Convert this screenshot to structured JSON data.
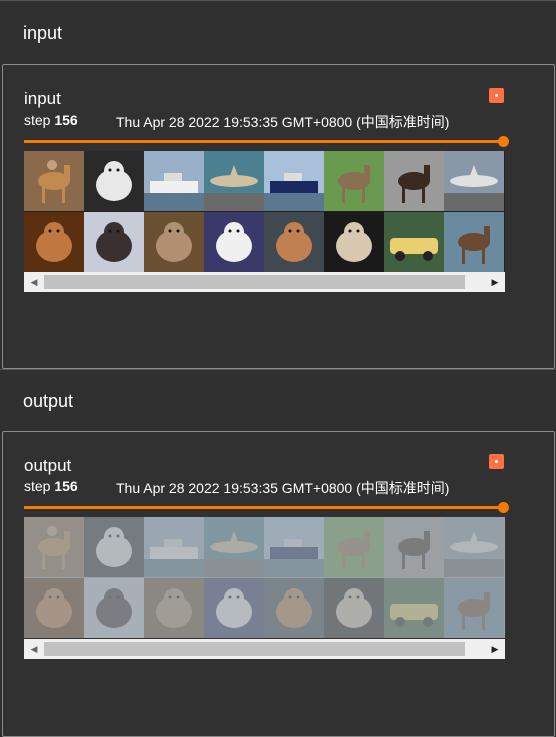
{
  "sections": [
    {
      "header": "input",
      "card": {
        "title": "input",
        "step_label": "step",
        "step_value": "156",
        "timestamp": "Thu Apr 28 2022 19:53:35 GMT+0800 (中国标准时间)",
        "slider_level": 1.0,
        "images_faded": false
      }
    },
    {
      "header": "output",
      "card": {
        "title": "output",
        "step_label": "step",
        "step_value": "156",
        "timestamp": "Thu Apr 28 2022 19:53:35 GMT+0800 (中国标准时间)",
        "slider_level": 1.0,
        "images_faded": true
      }
    }
  ],
  "images": [
    {
      "subject": "horse-rider",
      "bg": "#8a6a4a",
      "fg": "#c08a50"
    },
    {
      "subject": "dog",
      "bg": "#2a2a2a",
      "fg": "#e8e8e8"
    },
    {
      "subject": "ship",
      "bg": "#9ab0c8",
      "fg": "#f0f0f0"
    },
    {
      "subject": "airplane",
      "bg": "#4a8090",
      "fg": "#d0c0a0"
    },
    {
      "subject": "ship",
      "bg": "#a8c0d8",
      "fg": "#1a2a60"
    },
    {
      "subject": "deer",
      "bg": "#6a9a50",
      "fg": "#8a7050"
    },
    {
      "subject": "horse",
      "bg": "#9a9a9a",
      "fg": "#3a2a20"
    },
    {
      "subject": "airplane",
      "bg": "#8898a8",
      "fg": "#e0e0e0"
    },
    {
      "subject": "cat",
      "bg": "#5a3010",
      "fg": "#c07840"
    },
    {
      "subject": "dog",
      "bg": "#c8ccd8",
      "fg": "#3a3030"
    },
    {
      "subject": "cat",
      "bg": "#6a5030",
      "fg": "#b09070"
    },
    {
      "subject": "cat",
      "bg": "#3a3a6a",
      "fg": "#f0f0f0"
    },
    {
      "subject": "dog",
      "bg": "#404850",
      "fg": "#c08050"
    },
    {
      "subject": "dog",
      "bg": "#1a1a1a",
      "fg": "#d8c8b0"
    },
    {
      "subject": "car",
      "bg": "#406040",
      "fg": "#e8d070"
    },
    {
      "subject": "horse",
      "bg": "#6a8aa0",
      "fg": "#6a4a30"
    }
  ],
  "colors": {
    "accent": "#f57c00",
    "pin": "#ff7043",
    "background": "#2f2f2f"
  },
  "icons": {
    "pin": "pin-icon",
    "scroll_left": "◀",
    "scroll_right": "▶"
  }
}
